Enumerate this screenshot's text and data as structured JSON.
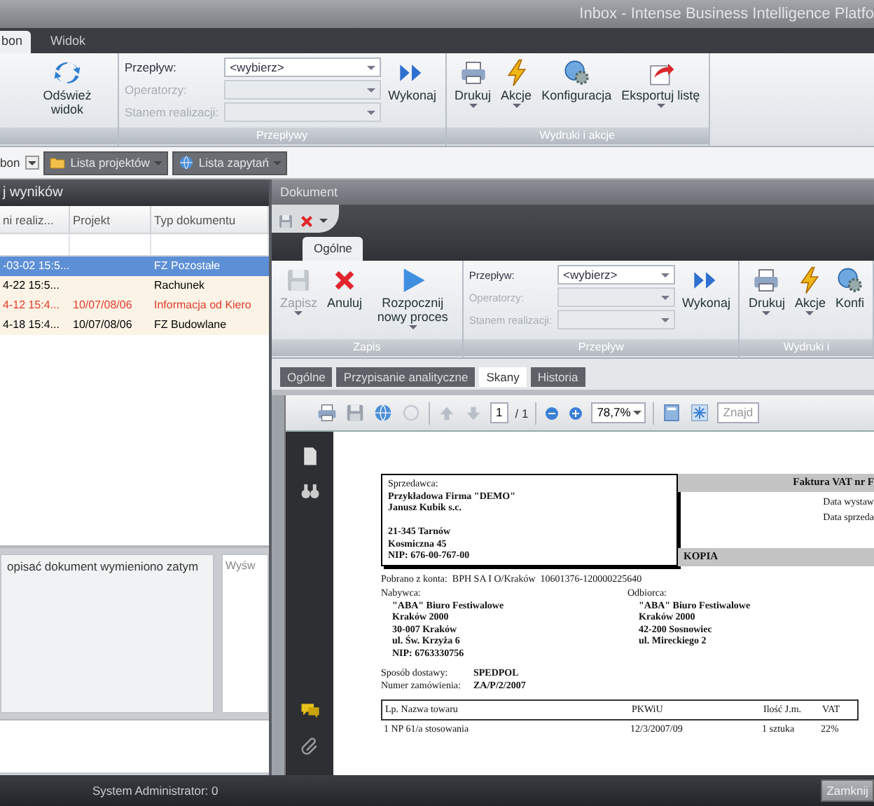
{
  "window": {
    "title": "Inbox - Intense Business Intelligence Platfo"
  },
  "menu_tabs": [
    {
      "label": "bon",
      "selected": true
    },
    {
      "label": "Widok",
      "selected": false
    }
  ],
  "ribbon": {
    "groups": [
      {
        "items": [
          {
            "label": "Odśwież widok",
            "dropdown": false,
            "disabled": false
          }
        ]
      },
      {
        "caption": "Przepływy",
        "form": {
          "fields": [
            {
              "label": "Przepływ:",
              "value": "<wybierz>",
              "disabled": false
            },
            {
              "label": "Operatorzy:",
              "disabled": true
            },
            {
              "label": "Stanem realizacji:",
              "disabled": true
            }
          ]
        },
        "items": [
          {
            "label": "Wykonaj",
            "dropdown": false,
            "disabled": false
          }
        ]
      },
      {
        "caption": "Wydruki i akcje",
        "items": [
          {
            "label": "Drukuj",
            "dropdown": true,
            "disabled": false
          },
          {
            "label": "Akcje",
            "dropdown": true,
            "disabled": false
          },
          {
            "label": "Konfiguracja",
            "dropdown": false,
            "disabled": false
          },
          {
            "label": "Eksportuj listę",
            "dropdown": true,
            "disabled": false
          }
        ]
      }
    ]
  },
  "views": [
    {
      "kind": "combo",
      "label": "bon"
    },
    {
      "kind": "tab",
      "label": "Lista projektów"
    },
    {
      "kind": "tab",
      "label": "Lista zapytań"
    }
  ],
  "results": {
    "title": "j wyników",
    "columns": [
      "ni realiz...",
      "Projekt",
      "Typ dokumentu"
    ],
    "rows": [
      {
        "cells": [
          "-03-02 15:5...",
          "",
          "FZ Pozostałe"
        ],
        "selected": true,
        "overdue": false,
        "unread": false
      },
      {
        "cells": [
          "4-22 15:5...",
          "",
          "Rachunek"
        ],
        "selected": false,
        "overdue": false,
        "unread": true
      },
      {
        "cells": [
          "4-12 15:4...",
          "10/07/08/06",
          "Informacja od Kiero"
        ],
        "selected": false,
        "overdue": true,
        "unread": true
      },
      {
        "cells": [
          "4-18 15:4...",
          "10/07/08/06",
          "FZ Budowlane"
        ],
        "selected": false,
        "overdue": false,
        "unread": true
      }
    ],
    "description": "opisać dokument wymieniono zatym",
    "side_label": "Wyśw"
  },
  "document": {
    "title": "Dokument",
    "tabs": [
      {
        "label": "Ogólne",
        "selected": true
      }
    ],
    "ribbon": {
      "groups": [
        {
          "caption": "Zapis",
          "items": [
            {
              "label": "Zapisz",
              "dropdown": true,
              "disabled": true
            },
            {
              "label": "Anuluj",
              "dropdown": false,
              "disabled": false
            },
            {
              "label": "Rozpocznij nowy proces",
              "dropdown": true,
              "disabled": false
            }
          ]
        },
        {
          "caption": "Przepływ",
          "form": {
            "fields": [
              {
                "label": "Przepływ:",
                "value": "<wybierz>",
                "disabled": false
              },
              {
                "label": "Operatorzy:",
                "disabled": true
              },
              {
                "label": "Stanem realizacji:",
                "disabled": true
              }
            ]
          },
          "items": [
            {
              "label": "Wykonaj",
              "dropdown": false,
              "disabled": false
            }
          ]
        },
        {
          "caption": "Wydruki i",
          "items": [
            {
              "label": "Drukuj",
              "dropdown": true,
              "disabled": false
            },
            {
              "label": "Akcje",
              "dropdown": true,
              "disabled": false
            },
            {
              "label": "Konfi",
              "dropdown": false,
              "disabled": false
            }
          ]
        }
      ]
    },
    "subtabs": [
      {
        "label": "Ogólne",
        "selected": false
      },
      {
        "label": "Przypisanie analityczne",
        "selected": false
      },
      {
        "label": "Skany",
        "selected": true
      },
      {
        "label": "Historia",
        "selected": false
      }
    ],
    "viewer": {
      "page": "1",
      "page_count": "/ 1",
      "zoom": "78,7%",
      "placeholder": "Znajd"
    },
    "invoice": {
      "seller_label": "Sprzedawca:",
      "seller_lines": [
        "Przykładowa Firma \"DEMO\"",
        "Janusz Kubik s.c.",
        "21-345 Tarnów",
        "Kosmiczna 45",
        "NIP: 676-00-767-00"
      ],
      "heading": "Faktura VAT nr F",
      "dates": [
        "Data wystaw",
        "Data sprzeda"
      ],
      "copy": "KOPIA",
      "account": "Pobrano z konta:  BPH SA I O/Kraków  10601376-120000225640",
      "parties": [
        {
          "label": "Nabywca:",
          "lines": [
            "\"ABA\" Biuro Festiwalowe",
            "Kraków 2000",
            "30-007 Kraków",
            "ul. Św. Krzyża 6",
            "NIP: 6763330756"
          ]
        },
        {
          "label": "Odbiorca:",
          "lines": [
            "\"ABA\" Biuro Festiwalowe",
            "Kraków 2000",
            "42-200 Sosnowiec",
            "ul. Mireckiego 2"
          ]
        }
      ],
      "delivery": [
        {
          "label": "Sposób dostawy:",
          "value": "SPEDPOL"
        },
        {
          "label": "Numer zamówienia:",
          "value": "ZA/P/2/2007"
        }
      ],
      "table": {
        "columns": [
          "Lp.  Nazwa towaru",
          "PKWiU",
          "Ilość J.m.",
          "VAT"
        ],
        "rows": [
          [
            "1  NP 61/a stosowania",
            "12/3/2007/09",
            "1 sztuka",
            "22%"
          ]
        ]
      }
    }
  },
  "status_bar": {
    "user": "System Administrator: 0",
    "button": "Zamknij"
  }
}
